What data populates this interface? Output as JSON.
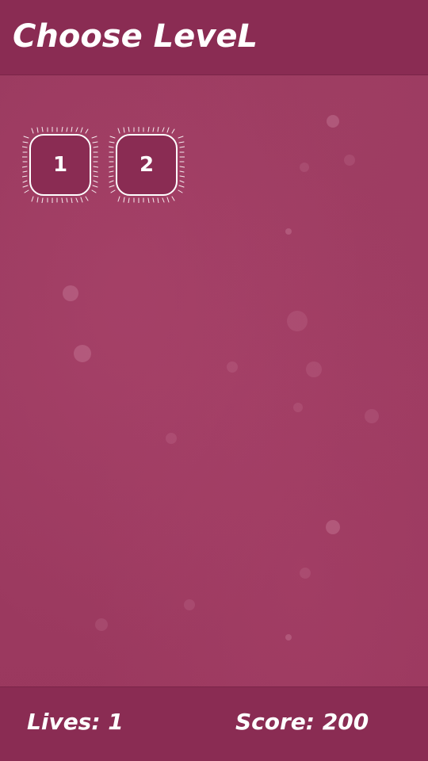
{
  "header": {
    "title": "Choose LeveL"
  },
  "levels": [
    {
      "label": "1"
    },
    {
      "label": "2"
    }
  ],
  "footer": {
    "lives": "Lives: 1",
    "score": "Score: 200"
  },
  "colors": {
    "background": "#9c3a60",
    "bar": "#8a2c53",
    "text": "#ffffff"
  }
}
